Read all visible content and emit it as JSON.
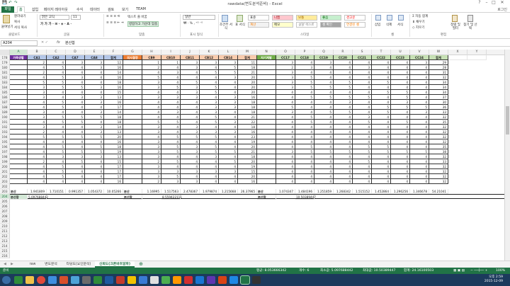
{
  "window": {
    "title": "rawdata(변도분석준비) - Excel",
    "user": "로그인"
  },
  "quick_access": {
    "save": "💾",
    "undo": "↶",
    "redo": "↷"
  },
  "tabs": {
    "file": "파일",
    "items": [
      "홈",
      "삽입",
      "페이지 레이아웃",
      "수식",
      "데이터",
      "검토",
      "보기",
      "TEAM"
    ]
  },
  "ribbon": {
    "clipboard": {
      "cut": "잘라내기",
      "copy": "복사",
      "paste_format": "서식 복사",
      "paste": "붙여넣기",
      "label": "클립보드"
    },
    "font": {
      "name": "맑은 고딕",
      "size": "11",
      "label": "글꼴"
    },
    "align": {
      "wrap": "텍스트 줄 바꿈",
      "merge": "병합하고 가운데 맞춤",
      "label": "맞춤"
    },
    "number": {
      "format": "일반",
      "label": "표시 형식"
    },
    "styles": {
      "cond": "조건부 서식",
      "table": "표 서식",
      "cells": [
        "표준",
        "나쁨",
        "보통",
        "좋음",
        "경고문",
        "계산",
        "메모",
        "설명 텍스트",
        "셀 확인",
        "연결된 셀"
      ],
      "label": "스타일"
    },
    "cells_grp": {
      "insert": "삽입",
      "delete": "삭제",
      "format": "서식",
      "label": "셀"
    },
    "edit": {
      "autosum": "자동 합계",
      "fill": "채우기",
      "clear": "지우기",
      "sort": "정렬 및 필터",
      "find": "찾기 및 선택",
      "label": "편집"
    }
  },
  "formula_bar": {
    "cell": "A204",
    "fx": "fx",
    "value": "분산합"
  },
  "columns": [
    "A",
    "B",
    "C",
    "D",
    "E",
    "F",
    "G",
    "H",
    "I",
    "J",
    "K",
    "L",
    "M",
    "N",
    "O",
    "P",
    "Q",
    "R",
    "S",
    "T",
    "U",
    "V",
    "W",
    "X",
    "Y"
  ],
  "header_row": {
    "num": "178",
    "cells": [
      "가족생활",
      "CA1",
      "CA2",
      "CA7",
      "CA8",
      "합계",
      "의사결정",
      "CB9",
      "CB10",
      "CB11",
      "CB12",
      "CB14",
      "합계",
      "자기계발",
      "CC17",
      "CC18",
      "CC19",
      "CC20",
      "CC21",
      "CC22",
      "CC23",
      "CC24",
      "합계",
      "",
      ""
    ]
  },
  "data_rows": [
    {
      "num": "179",
      "cells": [
        "",
        "2",
        "4",
        "3",
        "3",
        "12",
        "",
        "1",
        "1",
        "3",
        "3",
        "3",
        "11",
        "",
        "3",
        "4",
        "3",
        "4",
        "4",
        "4",
        "4",
        "3",
        "29"
      ]
    },
    {
      "num": "180",
      "cells": [
        "",
        "4",
        "5",
        "4",
        "3",
        "16",
        "",
        "2",
        "4",
        "3",
        "4",
        "5",
        "18",
        "",
        "2",
        "3",
        "4",
        "4",
        "3",
        "4",
        "4",
        "4",
        "28"
      ]
    },
    {
      "num": "181",
      "cells": [
        "",
        "2",
        "4",
        "4",
        "4",
        "14",
        "",
        "4",
        "3",
        "4",
        "5",
        "5",
        "21",
        "",
        "3",
        "4",
        "4",
        "4",
        "4",
        "4",
        "4",
        "4",
        "31"
      ]
    },
    {
      "num": "182",
      "cells": [
        "",
        "4",
        "5",
        "3",
        "4",
        "16",
        "",
        "5",
        "4",
        "4",
        "4",
        "3",
        "20",
        "",
        "3",
        "5",
        "4",
        "4",
        "4",
        "4",
        "4",
        "4",
        "32"
      ]
    },
    {
      "num": "183",
      "cells": [
        "",
        "5",
        "5",
        "4",
        "4",
        "18",
        "",
        "3",
        "4",
        "5",
        "4",
        "4",
        "20",
        "",
        "3",
        "5",
        "4",
        "5",
        "4",
        "5",
        "4",
        "4",
        "34"
      ]
    },
    {
      "num": "184",
      "cells": [
        "",
        "3",
        "5",
        "5",
        "3",
        "16",
        "",
        "3",
        "5",
        "3",
        "5",
        "4",
        "20",
        "",
        "3",
        "5",
        "5",
        "5",
        "4",
        "4",
        "4",
        "4",
        "34"
      ]
    },
    {
      "num": "185",
      "cells": [
        "",
        "3",
        "4",
        "4",
        "4",
        "15",
        "",
        "4",
        "4",
        "3",
        "5",
        "4",
        "20",
        "",
        "4",
        "4",
        "4",
        "4",
        "4",
        "5",
        "5",
        "4",
        "34"
      ]
    },
    {
      "num": "186",
      "cells": [
        "",
        "3",
        "4",
        "3",
        "3",
        "13",
        "",
        "3",
        "3",
        "3",
        "4",
        "3",
        "16",
        "",
        "4",
        "5",
        "5",
        "5",
        "5",
        "4",
        "5",
        "4",
        "37"
      ]
    },
    {
      "num": "187",
      "cells": [
        "",
        "4",
        "5",
        "4",
        "3",
        "16",
        "",
        "4",
        "4",
        "4",
        "3",
        "3",
        "18",
        "",
        "4",
        "4",
        "4",
        "3",
        "4",
        "4",
        "3",
        "4",
        "30"
      ]
    },
    {
      "num": "188",
      "cells": [
        "",
        "4",
        "5",
        "4",
        "4",
        "17",
        "",
        "4",
        "4",
        "4",
        "3",
        "3",
        "18",
        "",
        "5",
        "4",
        "4",
        "4",
        "4",
        "5",
        "5",
        "5",
        "36"
      ]
    },
    {
      "num": "189",
      "cells": [
        "",
        "3",
        "4",
        "4",
        "3",
        "14",
        "",
        "4",
        "3",
        "4",
        "3",
        "4",
        "18",
        "",
        "3",
        "4",
        "5",
        "5",
        "4",
        "5",
        "4",
        "3",
        "33"
      ]
    },
    {
      "num": "190",
      "cells": [
        "",
        "3",
        "5",
        "5",
        "5",
        "18",
        "",
        "4",
        "4",
        "4",
        "5",
        "4",
        "21",
        "",
        "4",
        "5",
        "4",
        "4",
        "3",
        "4",
        "4",
        "4",
        "32"
      ]
    },
    {
      "num": "191",
      "cells": [
        "",
        "4",
        "5",
        "5",
        "4",
        "18",
        "",
        "5",
        "5",
        "4",
        "5",
        "3",
        "22",
        "",
        "4",
        "5",
        "4",
        "4",
        "5",
        "4",
        "5",
        "4",
        "35"
      ]
    },
    {
      "num": "192",
      "cells": [
        "",
        "3",
        "4",
        "4",
        "3",
        "14",
        "",
        "3",
        "4",
        "3",
        "4",
        "4",
        "18",
        "",
        "4",
        "4",
        "4",
        "4",
        "4",
        "4",
        "4",
        "4",
        "32"
      ]
    },
    {
      "num": "193",
      "cells": [
        "",
        "2",
        "4",
        "4",
        "3",
        "13",
        "",
        "3",
        "4",
        "3",
        "3",
        "3",
        "16",
        "",
        "4",
        "4",
        "4",
        "4",
        "4",
        "4",
        "4",
        "4",
        "32"
      ]
    },
    {
      "num": "194",
      "cells": [
        "",
        "5",
        "5",
        "5",
        "5",
        "20",
        "",
        "4",
        "5",
        "5",
        "5",
        "4",
        "23",
        "",
        "4",
        "4",
        "4",
        "4",
        "4",
        "4",
        "4",
        "4",
        "32"
      ]
    },
    {
      "num": "195",
      "cells": [
        "",
        "4",
        "4",
        "4",
        "4",
        "16",
        "",
        "3",
        "4",
        "4",
        "4",
        "4",
        "19",
        "",
        "4",
        "4",
        "4",
        "4",
        "4",
        "4",
        "4",
        "4",
        "32"
      ]
    },
    {
      "num": "196",
      "cells": [
        "",
        "4",
        "5",
        "4",
        "5",
        "18",
        "",
        "3",
        "5",
        "3",
        "5",
        "4",
        "20",
        "",
        "4",
        "5",
        "4",
        "4",
        "5",
        "5",
        "4",
        "4",
        "35"
      ]
    },
    {
      "num": "197",
      "cells": [
        "",
        "4",
        "5",
        "5",
        "5",
        "19",
        "",
        "3",
        "5",
        "3",
        "5",
        "5",
        "21",
        "",
        "3",
        "5",
        "5",
        "5",
        "5",
        "5",
        "5",
        "5",
        "38"
      ]
    },
    {
      "num": "198",
      "cells": [
        "",
        "4",
        "3",
        "3",
        "3",
        "13",
        "",
        "3",
        "4",
        "4",
        "3",
        "4",
        "18",
        "",
        "4",
        "4",
        "4",
        "4",
        "4",
        "4",
        "4",
        "4",
        "32"
      ]
    },
    {
      "num": "199",
      "cells": [
        "",
        "2",
        "4",
        "5",
        "4",
        "15",
        "",
        "2",
        "5",
        "4",
        "4",
        "5",
        "20",
        "",
        "4",
        "4",
        "4",
        "4",
        "5",
        "4",
        "4",
        "4",
        "33"
      ]
    },
    {
      "num": "200",
      "cells": [
        "",
        "4",
        "5",
        "4",
        "4",
        "17",
        "",
        "3",
        "4",
        "4",
        "4",
        "4",
        "19",
        "",
        "4",
        "4",
        "4",
        "4",
        "4",
        "4",
        "4",
        "4",
        "32"
      ]
    },
    {
      "num": "201",
      "cells": [
        "",
        "4",
        "5",
        "4",
        "4",
        "17",
        "",
        "3",
        "3",
        "3",
        "3",
        "3",
        "15",
        "",
        "4",
        "4",
        "4",
        "4",
        "4",
        "4",
        "4",
        "4",
        "32"
      ]
    },
    {
      "num": "202",
      "cells": [
        "",
        "4",
        "5",
        "4",
        "4",
        "17",
        "",
        "3",
        "5",
        "4",
        "4",
        "4",
        "20",
        "",
        "4",
        "4",
        "4",
        "4",
        "4",
        "4",
        "4",
        "4",
        "32"
      ]
    },
    {
      "num": "203",
      "cells": [
        "",
        "4",
        "4",
        "4",
        "4",
        "16",
        "",
        "2",
        "3",
        "3",
        "4",
        "4",
        "16",
        "",
        "4",
        "4",
        "4",
        "4",
        "4",
        "4",
        "4",
        "4",
        "32"
      ]
    }
  ],
  "blank_row": {
    "num": "202"
  },
  "variance_row": {
    "num": "203",
    "label": "분산",
    "cells": [
      "1.941809",
      "1.710151",
      "0.991357",
      "1.054372",
      "10.05266",
      "분산",
      "1.16995",
      "1.517563",
      "2.478367",
      "1.979874",
      "1.215668",
      "26.37965",
      "분산",
      "1.074347",
      "1.484196",
      "1.251859",
      "1.268342",
      "1.515152",
      "1.452864",
      "1.296256",
      "1.346678",
      "54.21041"
    ]
  },
  "sum_row": {
    "num": "204",
    "label": "분산합",
    "v1": "5.097688442",
    "label2": "분산합",
    "v2": "8.559422111",
    "label3": "분산합",
    "v3": "10.50389447"
  },
  "empty_rows": [
    "205",
    "206",
    "207",
    "208",
    "209",
    "210",
    "211",
    "212",
    "213",
    "214",
    "215",
    "216",
    "217",
    "218",
    "219"
  ],
  "sheets": [
    "raw",
    "변도분석",
    "타당도(요인분석)",
    "신뢰도(크론바흐알파)"
  ],
  "status": {
    "ready": "준비",
    "avg": "평균: 8.053666342",
    "count": "개수: 6",
    "sum_label": "최소값: 5.097688442",
    "max": "최대값: 10.50389447",
    "total": "합계: 24.16100503",
    "zoom": "100%"
  },
  "taskbar": {
    "time": "오후 2:59",
    "date": "2015-12-09"
  }
}
